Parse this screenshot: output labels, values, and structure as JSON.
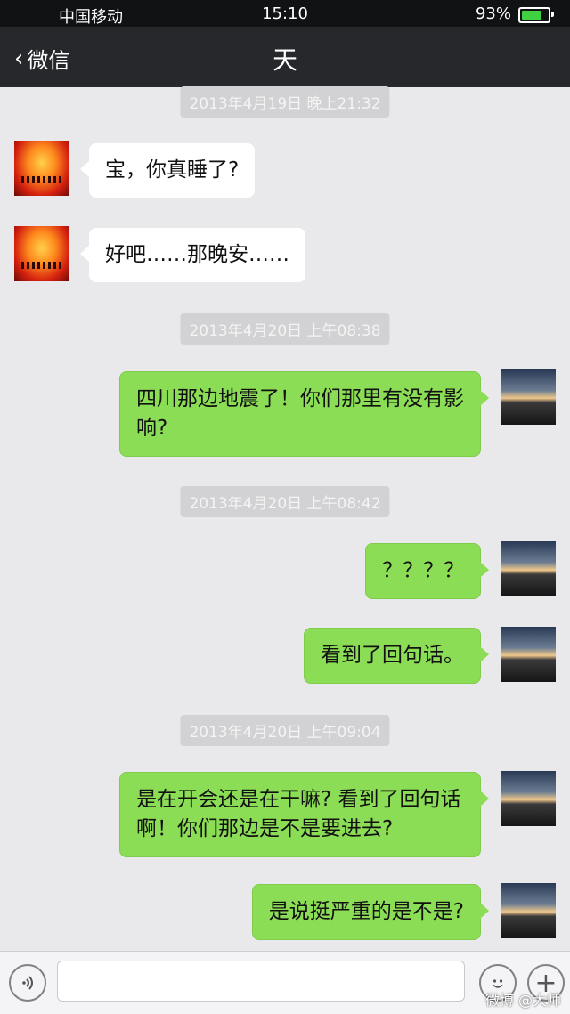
{
  "status_bar": {
    "carrier": "中国移动",
    "time": "15:10",
    "battery_percent": "93%",
    "battery_color": "#3fd142"
  },
  "nav": {
    "back_label": "微信",
    "title": "天"
  },
  "messages": {
    "ts1": "2013年4月19日 晚上21:32",
    "m1": "宝，你真睡了?",
    "m2": "好吧……那晚安……",
    "ts2": "2013年4月20日 上午08:38",
    "m3": "四川那边地震了！你们那里有没有影响?",
    "ts3": "2013年4月20日 上午08:42",
    "m4": "？？？？",
    "m5": "看到了回句话。",
    "ts4": "2013年4月20日 上午09:04",
    "m6": "是在开会还是在干嘛? 看到了回句话啊！你们那边是不是要进去?",
    "m7": "是说挺严重的是不是?"
  },
  "input_bar": {
    "voice_icon": "voice-icon",
    "emoji_icon": "emoji-icon",
    "plus_icon": "plus-icon"
  },
  "watermark": "微博 @大师",
  "colors": {
    "sent_bubble": "#8cdd56",
    "received_bubble": "#ffffff",
    "background": "#e9e9eb",
    "nav_bar": "#26282c"
  }
}
